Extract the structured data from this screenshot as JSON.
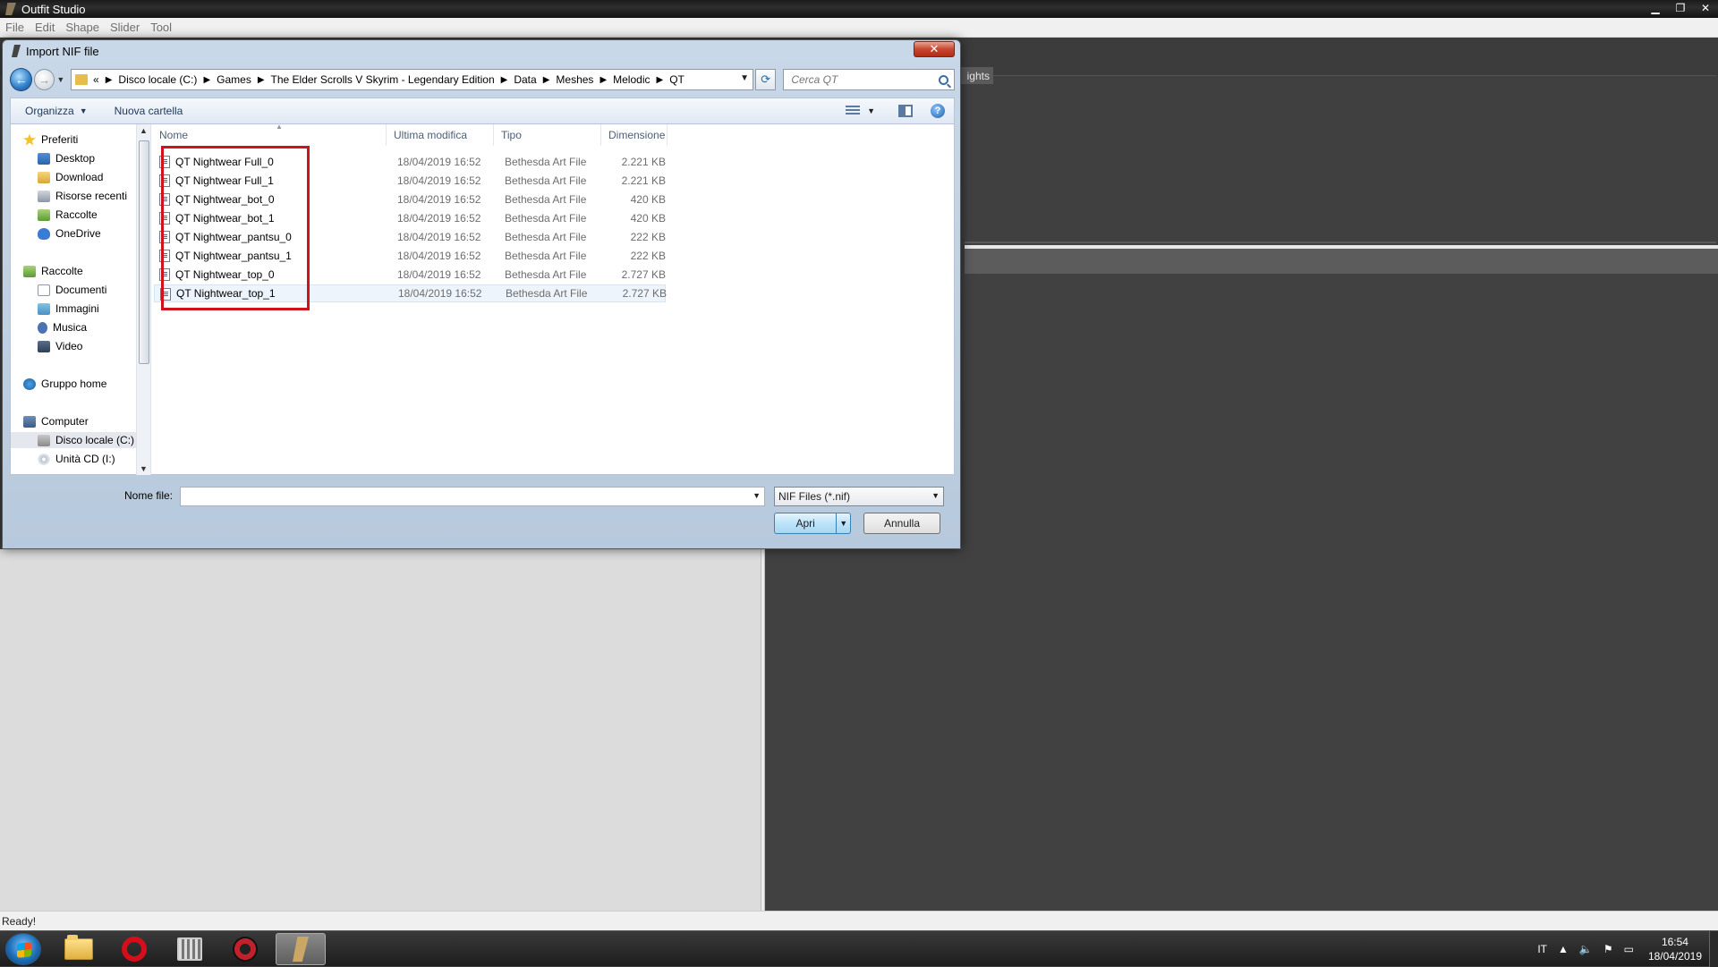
{
  "app": {
    "title": "Outfit Studio",
    "menu": [
      "File",
      "Edit",
      "Shape",
      "Slider",
      "Tool"
    ],
    "lights_tab": "ights",
    "status": "Ready!"
  },
  "dialog": {
    "title": "Import NIF file",
    "close_label": "✕",
    "address": {
      "overflow": "«",
      "crumbs": [
        "Disco locale (C:)",
        "Games",
        "The Elder Scrolls V Skyrim - Legendary Edition",
        "Data",
        "Meshes",
        "Melodic",
        "QT"
      ]
    },
    "search_placeholder": "Cerca QT",
    "toolbar": {
      "organize": "Organizza",
      "new_folder": "Nuova cartella"
    },
    "nav": {
      "favorites": {
        "label": "Preferiti",
        "items": [
          "Desktop",
          "Download",
          "Risorse recenti",
          "Raccolte",
          "OneDrive"
        ]
      },
      "libraries": {
        "label": "Raccolte",
        "items": [
          "Documenti",
          "Immagini",
          "Musica",
          "Video"
        ]
      },
      "homegroup": "Gruppo home",
      "computer": {
        "label": "Computer",
        "items": [
          "Disco locale (C:)",
          "Unità CD (I:)"
        ]
      }
    },
    "columns": {
      "name": "Nome",
      "modified": "Ultima modifica",
      "type": "Tipo",
      "size": "Dimensione"
    },
    "files": [
      {
        "name": "QT Nightwear Full_0",
        "modified": "18/04/2019 16:52",
        "type": "Bethesda Art File",
        "size": "2.221 KB"
      },
      {
        "name": "QT Nightwear Full_1",
        "modified": "18/04/2019 16:52",
        "type": "Bethesda Art File",
        "size": "2.221 KB"
      },
      {
        "name": "QT Nightwear_bot_0",
        "modified": "18/04/2019 16:52",
        "type": "Bethesda Art File",
        "size": "420 KB"
      },
      {
        "name": "QT Nightwear_bot_1",
        "modified": "18/04/2019 16:52",
        "type": "Bethesda Art File",
        "size": "420 KB"
      },
      {
        "name": "QT Nightwear_pantsu_0",
        "modified": "18/04/2019 16:52",
        "type": "Bethesda Art File",
        "size": "222 KB"
      },
      {
        "name": "QT Nightwear_pantsu_1",
        "modified": "18/04/2019 16:52",
        "type": "Bethesda Art File",
        "size": "222 KB"
      },
      {
        "name": "QT Nightwear_top_0",
        "modified": "18/04/2019 16:52",
        "type": "Bethesda Art File",
        "size": "2.727 KB"
      },
      {
        "name": "QT Nightwear_top_1",
        "modified": "18/04/2019 16:52",
        "type": "Bethesda Art File",
        "size": "2.727 KB"
      }
    ],
    "filename_label": "Nome file:",
    "filename_value": "",
    "filetype": "NIF Files (*.nif)",
    "open_label": "Apri",
    "cancel_label": "Annulla",
    "highlight_color": "#d0121b"
  },
  "taskbar": {
    "language": "IT",
    "time": "16:54",
    "date": "18/04/2019"
  }
}
